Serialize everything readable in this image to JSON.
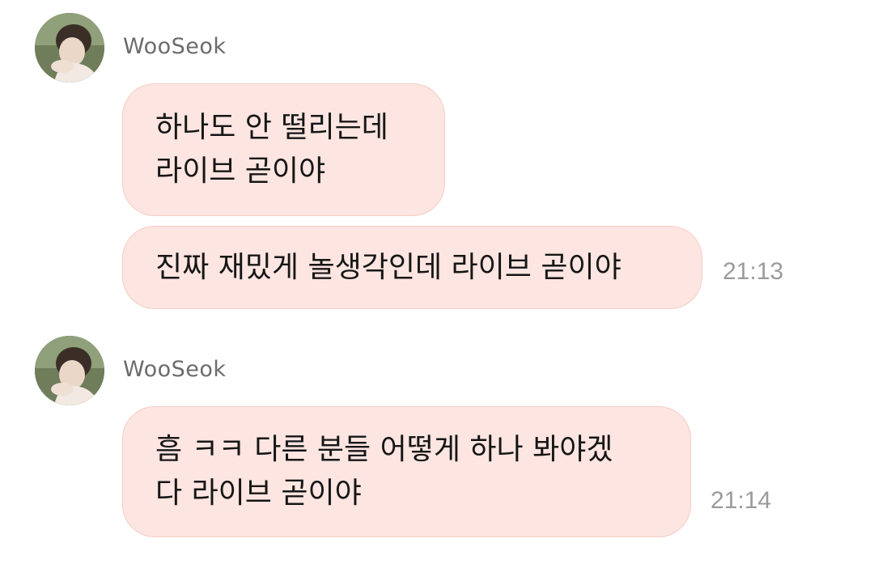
{
  "groups": [
    {
      "sender": "WooSeok",
      "messages": [
        {
          "lines": [
            "하나도 안 떨리는데",
            "라이브 곧이야"
          ],
          "time": ""
        },
        {
          "lines": [
            "진짜 재밌게 놀생각인데 라이브 곧이야"
          ],
          "time": "21:13"
        }
      ]
    },
    {
      "sender": "WooSeok",
      "messages": [
        {
          "lines": [
            "흠 ㅋㅋ 다른 분들 어떻게 하나 봐야겠",
            "다 라이브 곧이야"
          ],
          "time": "21:14"
        }
      ]
    }
  ],
  "colors": {
    "bubble": "#fde5e1",
    "bubble_border": "#f6cdc6",
    "sender": "#6b6b6b",
    "time": "#9b9b9b"
  },
  "icons": {
    "avatar": "profile-photo"
  }
}
